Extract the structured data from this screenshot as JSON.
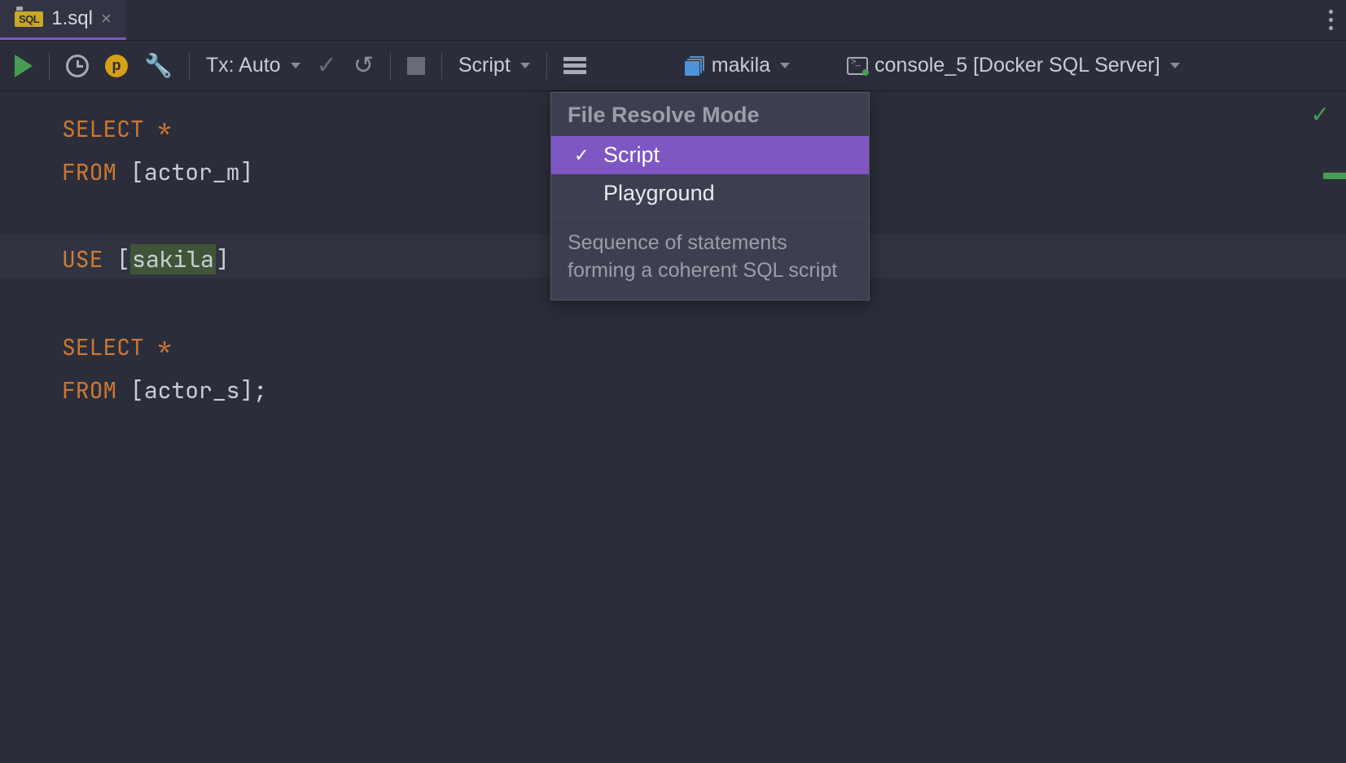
{
  "tab": {
    "icon_label": "SQL",
    "filename": "1.sql"
  },
  "toolbar": {
    "tx_label": "Tx: Auto",
    "script_label": "Script",
    "schema_label": "makila",
    "console_label": "console_5 [Docker SQL Server]",
    "p_badge": "p"
  },
  "dropdown": {
    "header": "File Resolve Mode",
    "items": [
      {
        "label": "Script",
        "selected": true
      },
      {
        "label": "Playground",
        "selected": false
      }
    ],
    "description": "Sequence of statements forming a coherent SQL script"
  },
  "code": {
    "line1_kw": "SELECT",
    "line1_rest": " *",
    "line2_kw": "FROM",
    "line2_open": " [",
    "line2_ident": "actor_m",
    "line2_close": "]",
    "line3_kw": "USE",
    "line3_open": " [",
    "line3_db": "sakila",
    "line3_close": "]",
    "line4_kw": "SELECT",
    "line4_rest": " *",
    "line5_kw": "FROM",
    "line5_open": " [",
    "line5_ident": "actor_s",
    "line5_close": "];"
  }
}
